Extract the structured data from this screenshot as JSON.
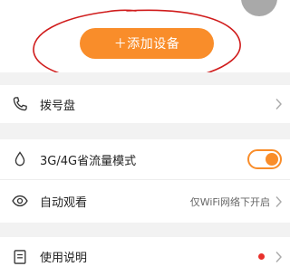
{
  "add_device": {
    "label": "＋添加设备"
  },
  "menu": {
    "dialpad": {
      "label": "拨号盘",
      "icon": "phone-icon"
    },
    "traffic_mode": {
      "label": "3G/4G省流量模式",
      "icon": "water-drop-icon",
      "enabled": true
    },
    "auto_watch": {
      "label": "自动观看",
      "icon": "eye-icon",
      "value": "仅WiFi网络下开启"
    },
    "manual": {
      "label": "使用说明",
      "icon": "book-icon",
      "has_badge": true
    }
  },
  "colors": {
    "accent": "#f98d2a",
    "badge": "#e8302b",
    "annotation": "#d01c1c"
  }
}
